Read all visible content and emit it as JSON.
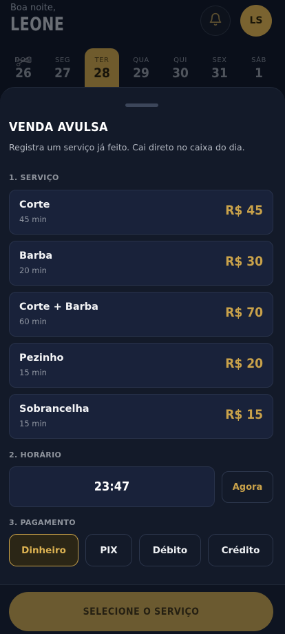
{
  "header": {
    "greeting": "Boa noite,",
    "user_name": "LEONE",
    "avatar_initials": "LS"
  },
  "calendar": {
    "days": [
      {
        "weekday": "DOM",
        "date": "26",
        "selected": false
      },
      {
        "weekday": "SEG",
        "date": "27",
        "selected": false
      },
      {
        "weekday": "TER",
        "date": "28",
        "selected": true
      },
      {
        "weekday": "QUA",
        "date": "29",
        "selected": false
      },
      {
        "weekday": "QUI",
        "date": "30",
        "selected": false
      },
      {
        "weekday": "SEX",
        "date": "31",
        "selected": false
      },
      {
        "weekday": "SÁB",
        "date": "1",
        "selected": false
      }
    ]
  },
  "sheet": {
    "title": "VENDA AVULSA",
    "subtitle": "Registra um serviço já feito. Cai direto no caixa do dia.",
    "service_section": "1. SERVIÇO",
    "services": [
      {
        "name": "Corte",
        "duration": "45 min",
        "price": "R$ 45"
      },
      {
        "name": "Barba",
        "duration": "20 min",
        "price": "R$ 30"
      },
      {
        "name": "Corte + Barba",
        "duration": "60 min",
        "price": "R$ 70"
      },
      {
        "name": "Pezinho",
        "duration": "15 min",
        "price": "R$ 20"
      },
      {
        "name": "Sobrancelha",
        "duration": "15 min",
        "price": "R$ 15"
      }
    ],
    "time_section": "2. HORÁRIO",
    "time_value": "23:47",
    "now_label": "Agora",
    "payment_section": "3. PAGAMENTO",
    "payments": [
      {
        "label": "Dinheiro",
        "selected": true
      },
      {
        "label": "PIX",
        "selected": false
      },
      {
        "label": "Débito",
        "selected": false
      },
      {
        "label": "Crédito",
        "selected": false
      }
    ],
    "cta_label": "SELECIONE O SERVIÇO"
  },
  "colors": {
    "accent": "#c9a24a",
    "sheet_bg": "#131a29",
    "card_bg": "#19223a",
    "cta_bg": "#6b5a30"
  }
}
